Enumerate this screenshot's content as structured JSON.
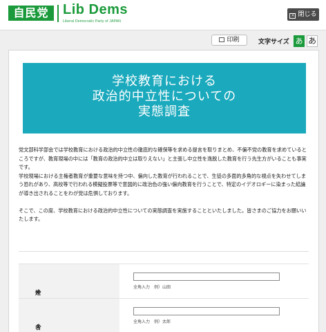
{
  "header": {
    "logo_jp": "自民党",
    "logo_en": "Lib Dems",
    "logo_sub": "Liberal Democratic Party of JAPAN",
    "close_label": "閉じる"
  },
  "toolbar": {
    "print_label": "印刷",
    "font_size_label": "文字サイズ",
    "font_small": "あ",
    "font_large": "あ"
  },
  "banner": {
    "lines": [
      "学校教育における",
      "政治的中立性についての",
      "実態調査"
    ]
  },
  "intro": {
    "p1": "党文部科学部会では学校教育における政治的中立性の徹底的な確保等を求める提言を取りまとめ、不偏不党の教育を求めているところですが、教育現場の中には「教育の政治的中立は取りえない」と主張し中立性を逸脱した教育を行う先生方がいることも事実です。",
    "p2": "学校現場における主権者教育が重要な意味を持つ中、偏向した教育が行われることで、生徒の多面的多角的な視点を失わせてしまう恐れがあり、高校等で行われる模擬投票等で意図的に政治色の強い偏向教育を行うことで、特定のイデオロギーに染まった結論が導き出されることをわが党は危惧しております。",
    "p3": "そこで、この度、学校教育における政治的中立性についての実態調査を実施することといたしました。皆さまのご協力をお願いいたします。"
  },
  "form": {
    "required_mark": "※",
    "fields": [
      {
        "label": "姓",
        "value": "",
        "hint": "全角入力　例）山田"
      },
      {
        "label": "名",
        "value": "",
        "hint": "全角入力　例）太郎"
      }
    ]
  }
}
